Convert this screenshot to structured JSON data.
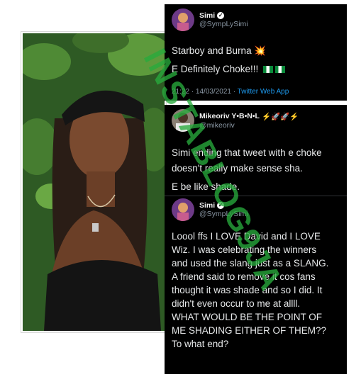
{
  "tweet1": {
    "name": "Simi",
    "handle": "@SympLySimi",
    "line1": "Starboy and Burna ",
    "line1_emoji": "💥",
    "line2": "E Definitely Choke!!! ",
    "time": "21:22 · 14/03/2021 · ",
    "via": "Twitter Web App"
  },
  "tweet2": {
    "name": "Mikeoriv Y•B•N•L",
    "name_emoji": "⚡🚀🚀⚡",
    "handle": "@mikeoriv",
    "line1": "Simi ending that tweet with e choke",
    "line2": "doesn't really make sense sha.",
    "line3": "E be like shade."
  },
  "tweet3": {
    "name": "Simi",
    "handle": "@SympLySimi",
    "lines": [
      "Loool ffs I LOVE David and I LOVE",
      "Wiz. I was celebrating the winners",
      "and used the slang just as a SLANG.",
      "A friend said to remove it cos fans",
      "thought it was shade and so I did. It",
      "didn't even occur to me at allll.",
      "WHAT WOULD BE THE POINT OF",
      "ME SHADING EITHER OF THEM??",
      "To what end?"
    ]
  },
  "watermark": "INSTABLOG9JA",
  "colors": {
    "card_bg": "#000000",
    "text": "#e7e9ea",
    "muted": "#8b98a5",
    "link": "#1d9bf0",
    "watermark": "#28aa3c"
  }
}
